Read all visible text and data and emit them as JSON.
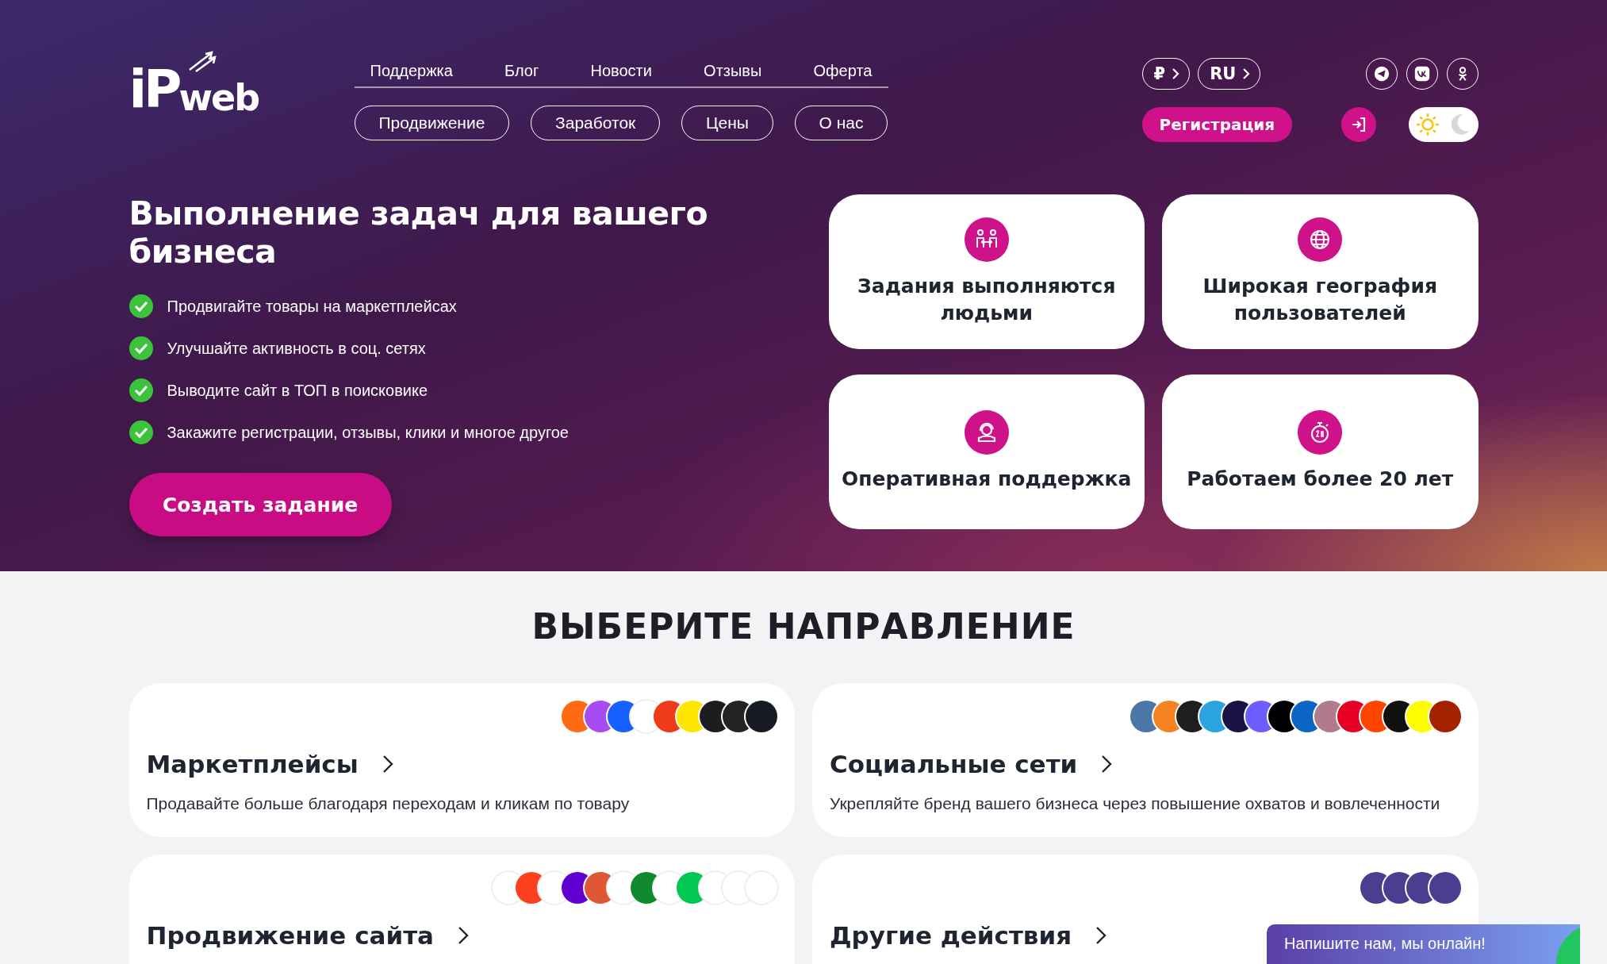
{
  "logo": {
    "text": "iP",
    "sub": "web"
  },
  "top_links": [
    "Поддержка",
    "Блог",
    "Новости",
    "Отзывы",
    "Оферта"
  ],
  "nav_pills": [
    "Продвижение",
    "Заработок",
    "Цены",
    "О нас"
  ],
  "currency": "₽",
  "language": "RU",
  "register_button": "Регистрация",
  "theme": {
    "dark": false
  },
  "hero": {
    "title": "Выполнение задач для вашего бизнеса",
    "checklist": [
      "Продвигайте товары на маркетплейсах",
      "Улучшайте активность в соц. сетях",
      "Выводите сайт в ТОП в поисковике",
      "Закажите регистрации, отзывы, клики и многое другое"
    ],
    "cta": "Создать задание"
  },
  "features": [
    {
      "kind": "people",
      "text": "Задания выполняются людьми"
    },
    {
      "kind": "globe",
      "text": "Широкая география пользователей"
    },
    {
      "kind": "support",
      "text": "Оперативная поддержка"
    },
    {
      "kind": "timer",
      "text": "Работаем более 20 лет"
    }
  ],
  "section_title": "ВЫБЕРИТЕ НАПРАВЛЕНИЕ",
  "directions": [
    {
      "title": "Маркетплейсы",
      "description": "Продавайте больше благодаря переходам и кликам по товару",
      "logos": [
        {
          "color": "#ff6a13"
        },
        {
          "color": "#a64cf0"
        },
        {
          "color": "#1560ff"
        },
        {
          "color": "#ffffff"
        },
        {
          "color": "#ef3b1a"
        },
        {
          "color": "#ffe600"
        },
        {
          "color": "#1d1d1f"
        },
        {
          "color": "#232323"
        },
        {
          "color": "#171a21"
        }
      ]
    },
    {
      "title": "Социальные сети",
      "description": "Укрепляйте бренд вашего бизнеса через повышение охватов и вовлеченности",
      "logos": [
        {
          "color": "#4a76a8"
        },
        {
          "color": "#f58220"
        },
        {
          "color": "#1f1f1f"
        },
        {
          "color": "#2aa3de"
        },
        {
          "color": "#1a1446"
        },
        {
          "color": "#6d5dfc"
        },
        {
          "color": "#000000"
        },
        {
          "color": "#0a66c2"
        },
        {
          "color": "#b07c8c"
        },
        {
          "color": "#e60023"
        },
        {
          "color": "#ff4500"
        },
        {
          "color": "#111111"
        },
        {
          "color": "#fffc00"
        },
        {
          "color": "#a62100"
        }
      ]
    },
    {
      "title": "Продвижение сайта",
      "logos": [
        {
          "color": "#ffffff"
        },
        {
          "color": "#fc3f1d"
        },
        {
          "color": "#ffffff"
        },
        {
          "color": "#6001d2"
        },
        {
          "color": "#de5833"
        },
        {
          "color": "#ffffff"
        },
        {
          "color": "#0f8a2e"
        },
        {
          "color": "#ffffff"
        },
        {
          "color": "#00c853"
        },
        {
          "color": "#ffffff"
        },
        {
          "color": "#ffffff"
        },
        {
          "color": "#ffffff"
        }
      ]
    },
    {
      "title": "Другие действия",
      "logos": [
        {
          "color": "#4b3d8f"
        },
        {
          "color": "#4b3d8f"
        },
        {
          "color": "#4b3d8f"
        },
        {
          "color": "#4b3d8f"
        }
      ]
    }
  ],
  "chat_widget": "Напишите нам, мы онлайн!"
}
